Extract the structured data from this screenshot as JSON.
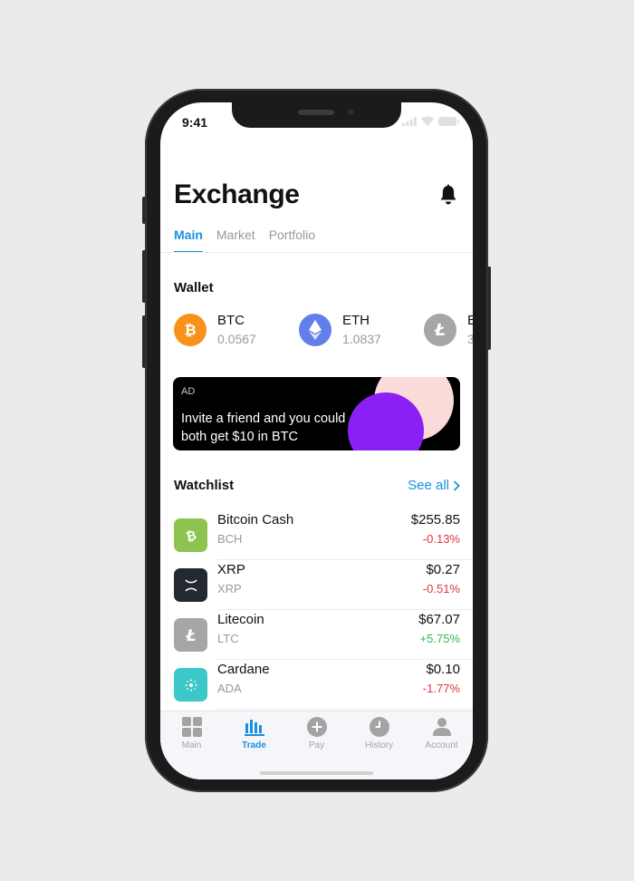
{
  "status_bar": {
    "time": "9:41"
  },
  "header": {
    "title": "Exchange"
  },
  "tabs": [
    {
      "label": "Main",
      "active": true
    },
    {
      "label": "Market",
      "active": false
    },
    {
      "label": "Portfolio",
      "active": false
    }
  ],
  "wallet": {
    "title": "Wallet",
    "items": [
      {
        "symbol": "BTC",
        "amount": "0.0567",
        "color": "#f7931a",
        "icon": "bitcoin-icon"
      },
      {
        "symbol": "ETH",
        "amount": "1.0837",
        "color": "#627eea",
        "icon": "ethereum-icon"
      },
      {
        "symbol": "B",
        "amount": "3",
        "color": "#a6a6a6",
        "icon": "litecoin-icon"
      }
    ]
  },
  "ad": {
    "label": "AD",
    "text": "Invite a friend and you could both get $10 in BTC"
  },
  "watchlist": {
    "title": "Watchlist",
    "see_all": "See all",
    "items": [
      {
        "name": "Bitcoin Cash",
        "symbol": "BCH",
        "price": "$255.85",
        "change": "-0.13%",
        "trend": "down",
        "color": "#8dc451",
        "icon": "bitcoin-cash-icon"
      },
      {
        "name": "XRP",
        "symbol": "XRP",
        "price": "$0.27",
        "change": "-0.51%",
        "trend": "down",
        "color": "#23292f",
        "icon": "xrp-icon"
      },
      {
        "name": "Litecoin",
        "symbol": "LTC",
        "price": "$67.07",
        "change": "+5.75%",
        "trend": "up",
        "color": "#a6a6a6",
        "icon": "litecoin-icon"
      },
      {
        "name": "Cardane",
        "symbol": "ADA",
        "price": "$0.10",
        "change": "-1.77%",
        "trend": "down",
        "color": "#3cc8c8",
        "icon": "cardano-icon"
      }
    ]
  },
  "tabbar": {
    "items": [
      {
        "label": "Main",
        "icon": "grid-icon",
        "active": false
      },
      {
        "label": "Trade",
        "icon": "bar-chart-icon",
        "active": true
      },
      {
        "label": "Pay",
        "icon": "plus-circle-icon",
        "active": false
      },
      {
        "label": "History",
        "icon": "clock-icon",
        "active": false
      },
      {
        "label": "Account",
        "icon": "person-icon",
        "active": false
      }
    ]
  },
  "colors": {
    "accent": "#1b8fe0",
    "negative": "#e0343f",
    "positive": "#33b84f",
    "ad_background": "#000000",
    "ad_pink": "#fbdada",
    "ad_purple": "#8b20f5"
  }
}
